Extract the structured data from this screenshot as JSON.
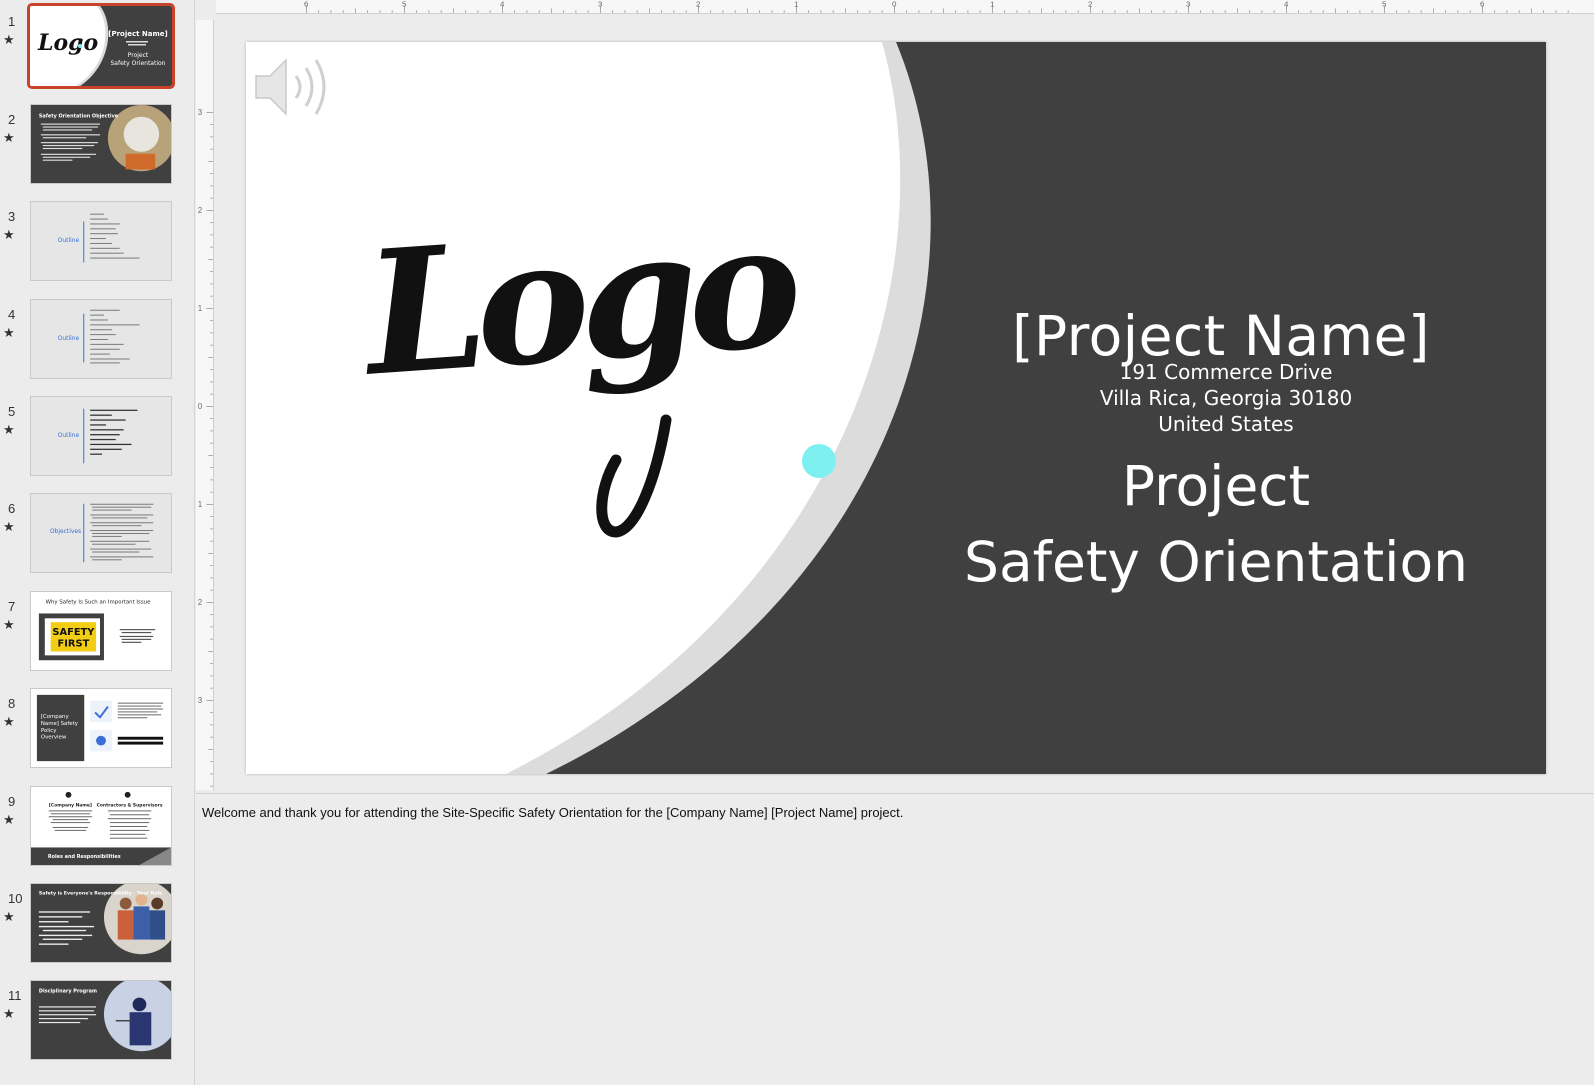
{
  "thumbnails": [
    {
      "number": "1",
      "star": "★",
      "title": "[Project Name]",
      "subtitle": "Project\nSafety Orientation",
      "logo": "Logo"
    },
    {
      "number": "2",
      "star": "★",
      "title": "Safety Orientation Objective"
    },
    {
      "number": "3",
      "star": "★",
      "heading": "Outline"
    },
    {
      "number": "4",
      "star": "★",
      "heading": "Outline"
    },
    {
      "number": "5",
      "star": "★",
      "heading": "Outline"
    },
    {
      "number": "6",
      "star": "★",
      "heading": "Objectives"
    },
    {
      "number": "7",
      "star": "★",
      "title": "Why Safety Is Such an Important Issue",
      "sign_line1": "SAFETY",
      "sign_line2": "FIRST"
    },
    {
      "number": "8",
      "star": "★",
      "heading": "[Company Name] Safety Policy Overview"
    },
    {
      "number": "9",
      "star": "★",
      "left_heading": "[Company Name]",
      "right_heading": "Contractors & Supervisors",
      "footer": "Roles and Responsibilities"
    },
    {
      "number": "10",
      "star": "★",
      "title": "Safety is Everyone's Responsibility - Your Role"
    },
    {
      "number": "11",
      "star": "★",
      "title": "Disciplinary Program"
    }
  ],
  "slide": {
    "logo_text": "Logo",
    "title": "[Project Name]",
    "address_line1": "191 Commerce Drive",
    "address_line2": "Villa Rica, Georgia 30180",
    "address_line3": "United States",
    "subtitle_line1": "Project",
    "subtitle_line2": "Safety Orientation",
    "audio_icon": "speaker-icon"
  },
  "notes": {
    "text": "Welcome and thank you for attending the Site-Specific Safety Orientation for the [Company Name] [Project Name] project."
  },
  "ruler": {
    "top_labels": [
      "6",
      "5",
      "4",
      "3",
      "2",
      "1",
      "0",
      "1",
      "2",
      "3",
      "4",
      "5",
      "6"
    ],
    "left_labels": [
      "3",
      "2",
      "1",
      "0",
      "1",
      "2",
      "3"
    ]
  },
  "colors": {
    "dark_panel": "#404040",
    "accent_dot": "#7ff0f0",
    "selected_border": "#c8432a",
    "outline_blue": "#3a6fd8",
    "sign_yellow": "#f2cd13"
  }
}
